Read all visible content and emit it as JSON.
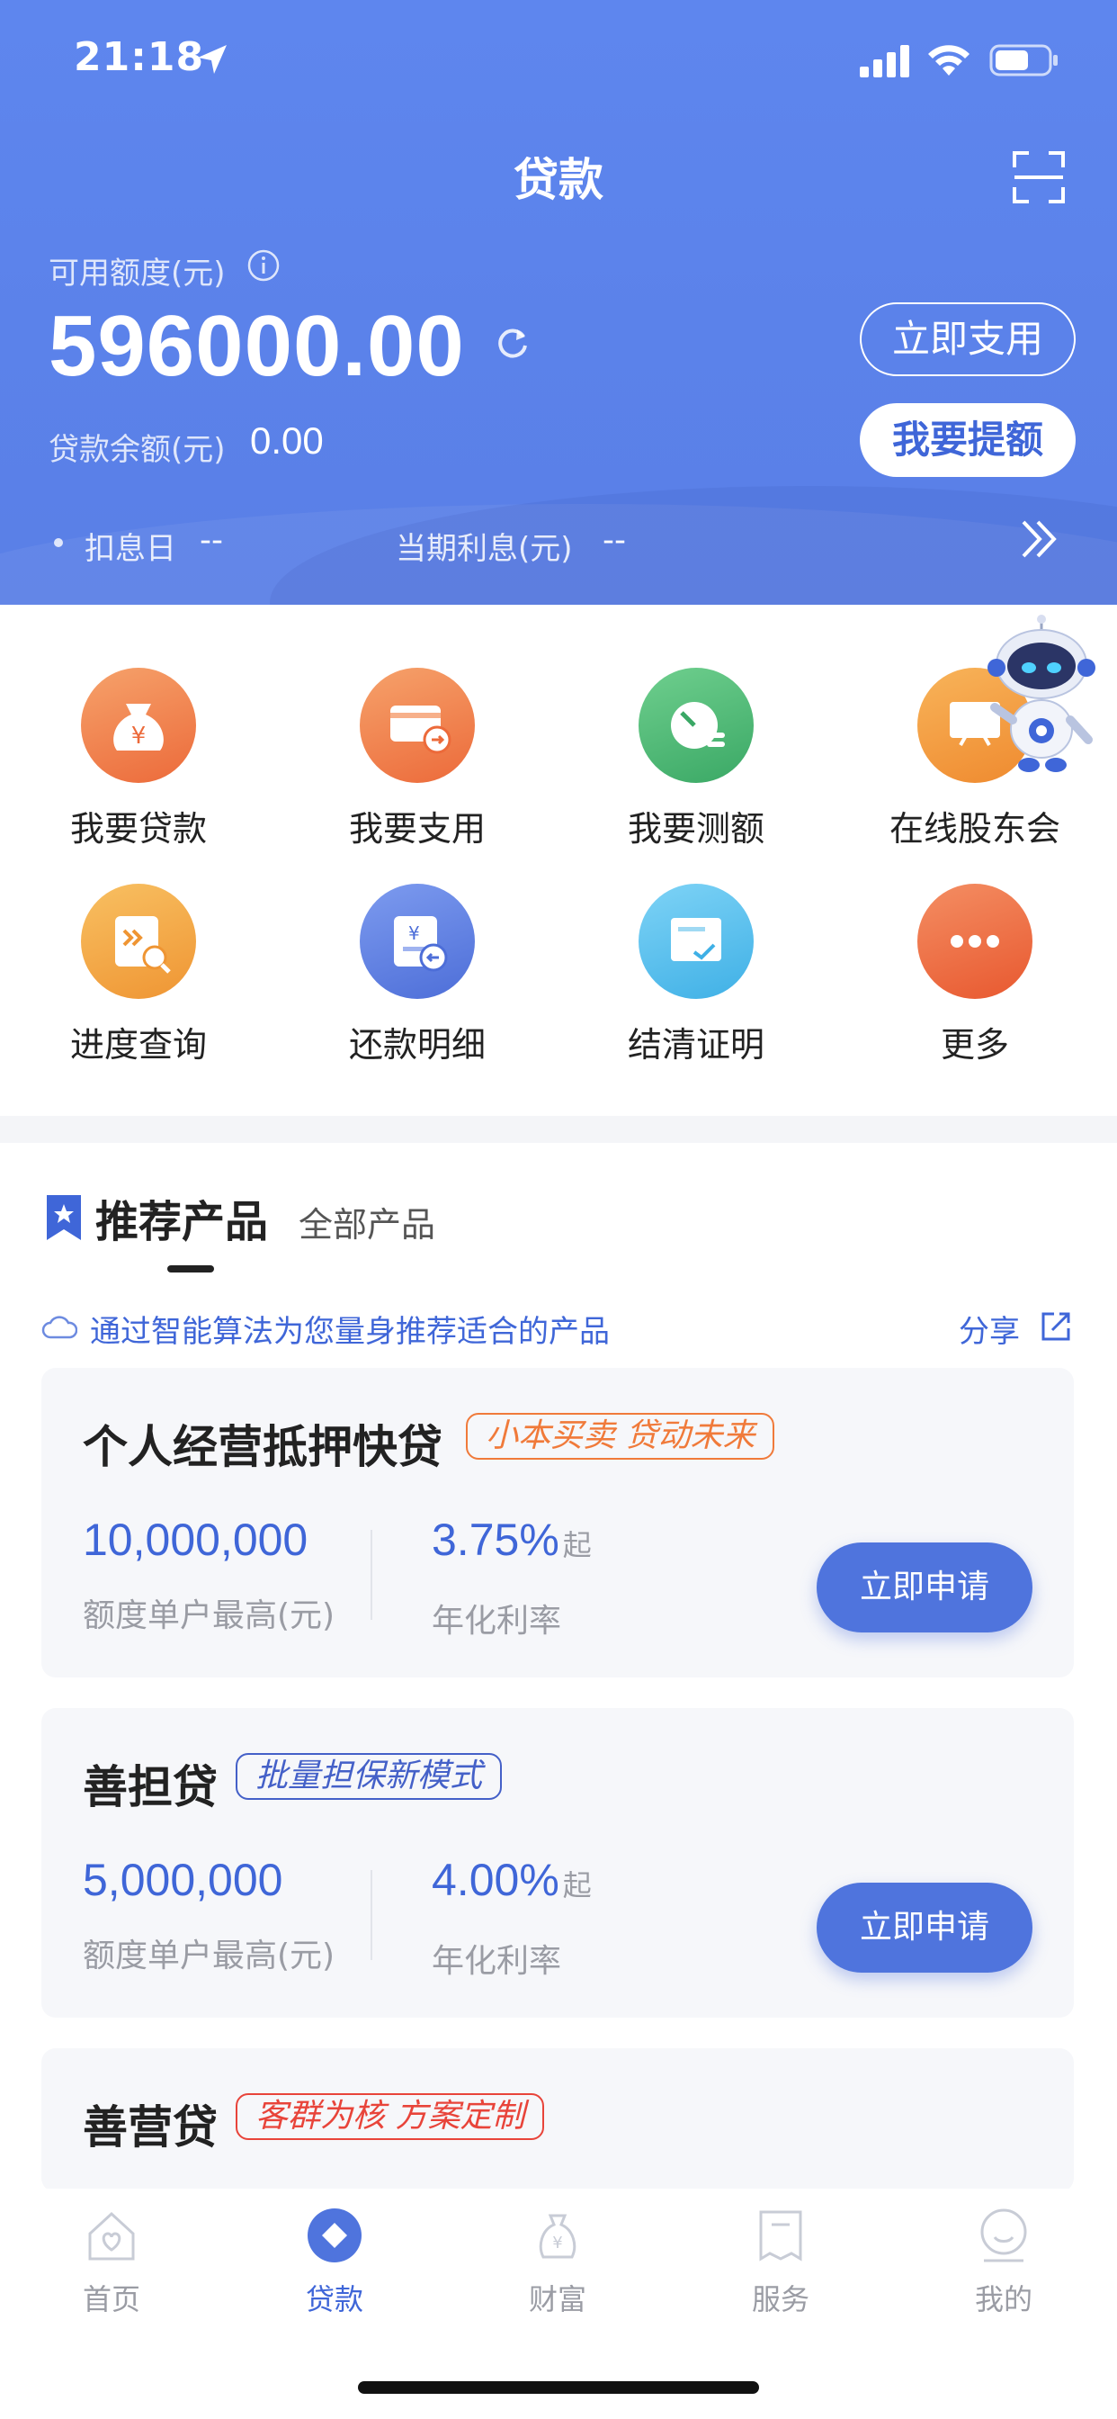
{
  "status_bar": {
    "time": "21:18"
  },
  "header": {
    "title": "贷款",
    "available_label": "可用额度(元)",
    "available_amount": "596000.00",
    "use_now_button": "立即支用",
    "raise_button": "我要提额",
    "balance_label": "贷款余额(元)",
    "balance_value": "0.00",
    "deduct_label": "扣息日",
    "deduct_value": "--",
    "interest_label": "当期利息(元)",
    "interest_value": "--"
  },
  "quick_actions": [
    {
      "label": "我要贷款",
      "icon": "money-bag-icon"
    },
    {
      "label": "我要支用",
      "icon": "card-arrow-icon"
    },
    {
      "label": "我要测额",
      "icon": "gauge-icon"
    },
    {
      "label": "在线股东会",
      "icon": "meeting-board-icon"
    },
    {
      "label": "进度查询",
      "icon": "progress-search-icon"
    },
    {
      "label": "还款明细",
      "icon": "repay-detail-icon"
    },
    {
      "label": "结清证明",
      "icon": "certificate-icon"
    },
    {
      "label": "更多",
      "icon": "more-icon"
    }
  ],
  "recommend": {
    "tab_recommended": "推荐产品",
    "tab_all": "全部产品",
    "hint": "通过智能算法为您量身推荐适合的产品",
    "share": "分享"
  },
  "products": [
    {
      "name": "个人经营抵押快贷",
      "tag": "小本买卖 贷动未来",
      "tag_color": "#f07a3a",
      "max_amount": "10,000,000",
      "max_label": "额度单户最高(元)",
      "rate": "3.75%",
      "rate_suffix": "起",
      "rate_label": "年化利率",
      "button": "立即申请"
    },
    {
      "name": "善担贷",
      "tag": "批量担保新模式",
      "tag_color": "#4460c8",
      "max_amount": "5,000,000",
      "max_label": "额度单户最高(元)",
      "rate": "4.00%",
      "rate_suffix": "起",
      "rate_label": "年化利率",
      "button": "立即申请"
    },
    {
      "name": "善营贷",
      "tag": "客群为核 方案定制",
      "tag_color": "#e8443a"
    }
  ],
  "tabbar": [
    {
      "label": "首页",
      "icon": "home-icon",
      "active": false
    },
    {
      "label": "贷款",
      "icon": "loan-icon",
      "active": true
    },
    {
      "label": "财富",
      "icon": "wealth-icon",
      "active": false
    },
    {
      "label": "服务",
      "icon": "service-icon",
      "active": false
    },
    {
      "label": "我的",
      "icon": "profile-icon",
      "active": false
    }
  ],
  "colors": {
    "primary": "#5b82ea",
    "accent_blue": "#3f66d8",
    "button_blue": "#4f74dd"
  }
}
